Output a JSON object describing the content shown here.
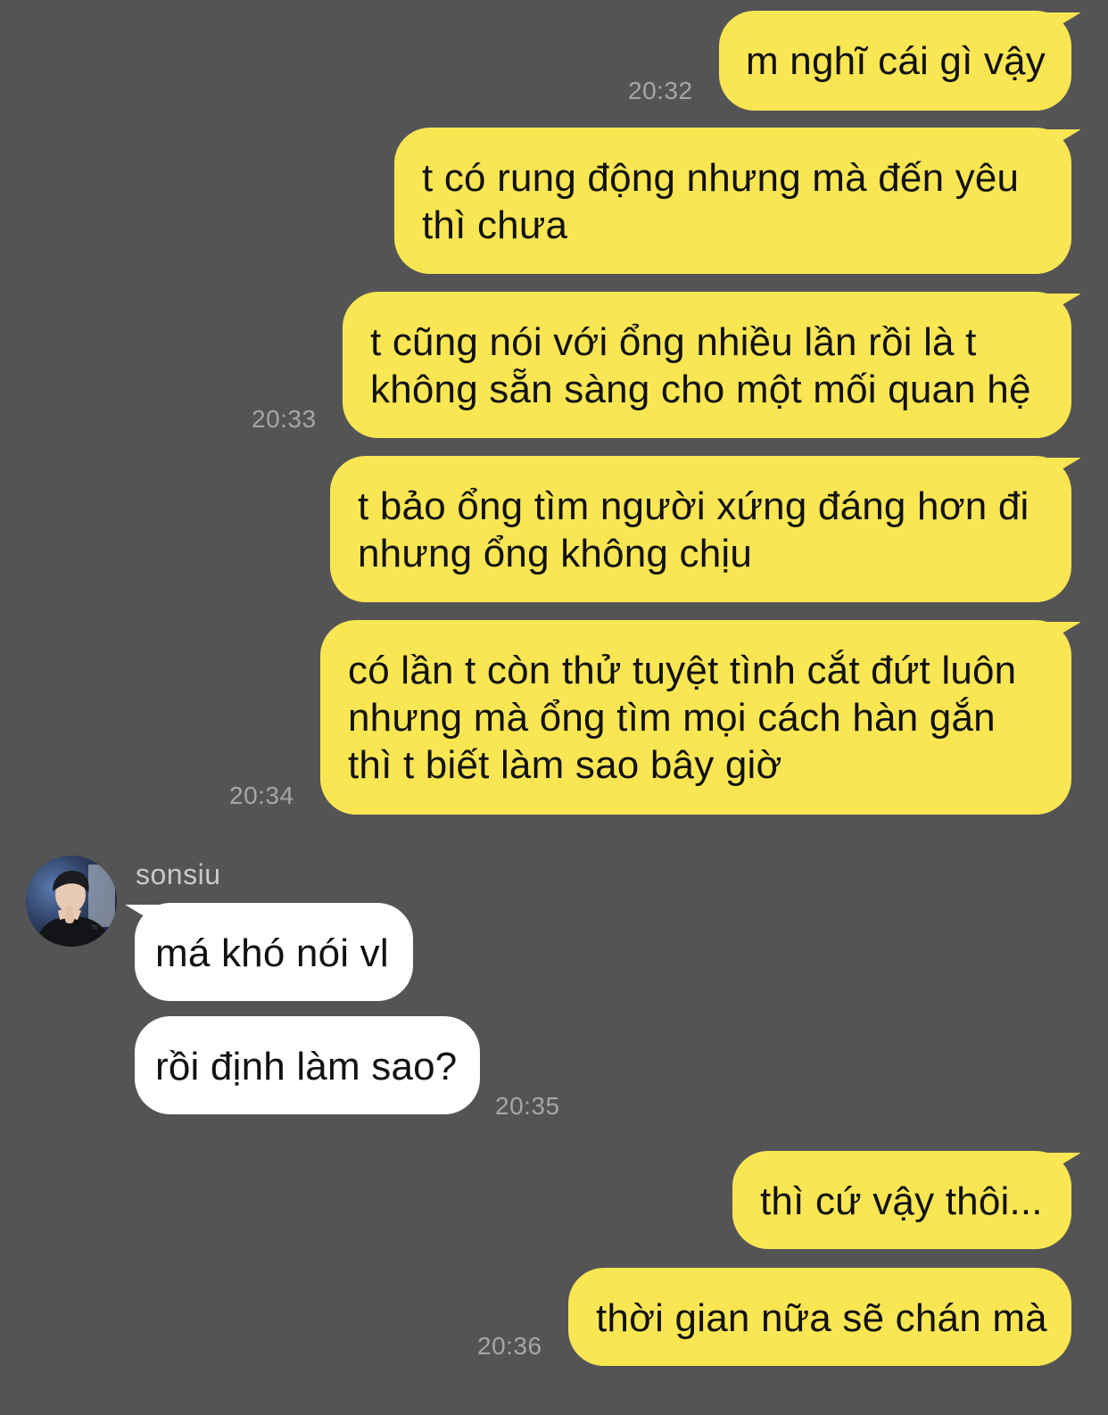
{
  "contact": {
    "name": "sonsiu"
  },
  "colors": {
    "background": "#545455",
    "outgoing_bubble": "#fae653",
    "incoming_bubble": "#ffffff",
    "timestamp": "#a6a6a8"
  },
  "messages": [
    {
      "sender": "me",
      "lines": [
        "m nghĩ cái gì vậy"
      ],
      "time": "20:32"
    },
    {
      "sender": "me",
      "lines": [
        "t có rung động nhưng mà đến yêu",
        "thì chưa"
      ],
      "time": ""
    },
    {
      "sender": "me",
      "lines": [
        "t cũng nói với ổng nhiều lần rồi là t",
        "không sẵn sàng cho một mối quan hệ"
      ],
      "time": "20:33"
    },
    {
      "sender": "me",
      "lines": [
        "t bảo ổng tìm người xứng đáng hơn đi",
        "nhưng ổng không chịu"
      ],
      "time": ""
    },
    {
      "sender": "me",
      "lines": [
        "có lần t còn thử tuyệt tình cắt đứt luôn",
        "nhưng mà ổng tìm mọi cách hàn gắn",
        "thì t biết làm sao bây giờ"
      ],
      "time": "20:34"
    },
    {
      "sender": "them",
      "lines": [
        "má khó nói vl"
      ],
      "time": ""
    },
    {
      "sender": "them",
      "lines": [
        "rồi định làm sao?"
      ],
      "time": "20:35"
    },
    {
      "sender": "me",
      "lines": [
        "thì cứ vậy thôi..."
      ],
      "time": ""
    },
    {
      "sender": "me",
      "lines": [
        "thời gian nữa sẽ chán mà"
      ],
      "time": "20:36"
    }
  ]
}
